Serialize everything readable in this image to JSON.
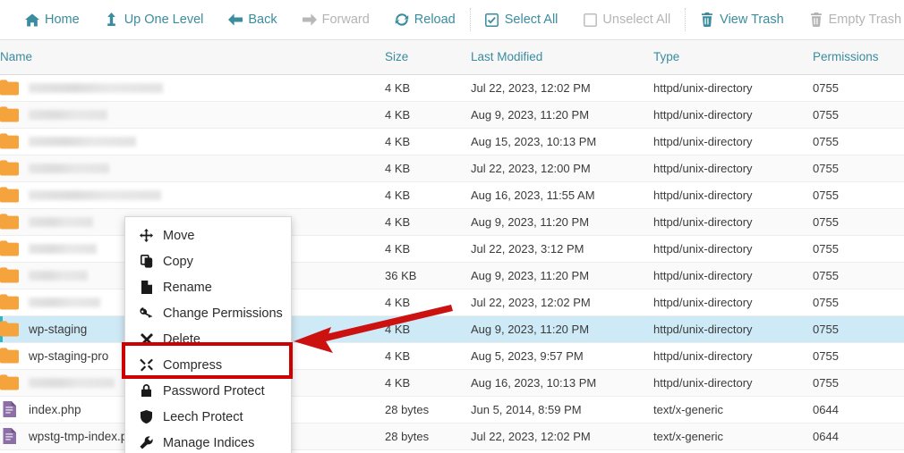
{
  "toolbar": {
    "items": [
      {
        "id": "home",
        "label": "Home",
        "icon": "home-icon",
        "disabled": false
      },
      {
        "id": "up-one-level",
        "label": "Up One Level",
        "icon": "arrow-up-icon",
        "disabled": false
      },
      {
        "id": "back",
        "label": "Back",
        "icon": "arrow-left-icon",
        "disabled": false
      },
      {
        "id": "forward",
        "label": "Forward",
        "icon": "arrow-right-icon",
        "disabled": true
      },
      {
        "id": "reload",
        "label": "Reload",
        "icon": "reload-icon",
        "disabled": false
      },
      {
        "id": "select-all",
        "label": "Select All",
        "icon": "checkbox-checked-icon",
        "disabled": false
      },
      {
        "id": "unselect-all",
        "label": "Unselect All",
        "icon": "checkbox-empty-icon",
        "disabled": true
      },
      {
        "id": "view-trash",
        "label": "View Trash",
        "icon": "trash-icon",
        "disabled": false
      },
      {
        "id": "empty-trash",
        "label": "Empty Trash",
        "icon": "trash-icon",
        "disabled": true
      }
    ]
  },
  "table": {
    "columns": [
      "Name",
      "Size",
      "Last Modified",
      "Type",
      "Permissions"
    ],
    "rows": [
      {
        "name": "",
        "redacted": true,
        "redact_w": 150,
        "icon": "folder-icon",
        "size": "4 KB",
        "modified": "Jul 22, 2023, 12:02 PM",
        "type": "httpd/unix-directory",
        "permissions": "0755",
        "selected": false
      },
      {
        "name": "",
        "redacted": true,
        "redact_w": 88,
        "icon": "folder-icon",
        "size": "4 KB",
        "modified": "Aug 9, 2023, 11:20 PM",
        "type": "httpd/unix-directory",
        "permissions": "0755",
        "selected": false
      },
      {
        "name": "",
        "redacted": true,
        "redact_w": 120,
        "icon": "folder-icon",
        "size": "4 KB",
        "modified": "Aug 15, 2023, 10:13 PM",
        "type": "httpd/unix-directory",
        "permissions": "0755",
        "selected": false
      },
      {
        "name": "",
        "redacted": true,
        "redact_w": 90,
        "icon": "folder-icon",
        "size": "4 KB",
        "modified": "Jul 22, 2023, 12:00 PM",
        "type": "httpd/unix-directory",
        "permissions": "0755",
        "selected": false
      },
      {
        "name": "",
        "redacted": true,
        "redact_w": 148,
        "icon": "folder-icon",
        "size": "4 KB",
        "modified": "Aug 16, 2023, 11:55 AM",
        "type": "httpd/unix-directory",
        "permissions": "0755",
        "selected": false
      },
      {
        "name": "",
        "redacted": true,
        "redact_w": 72,
        "icon": "folder-icon",
        "size": "4 KB",
        "modified": "Aug 9, 2023, 11:20 PM",
        "type": "httpd/unix-directory",
        "permissions": "0755",
        "selected": false
      },
      {
        "name": "",
        "redacted": true,
        "redact_w": 76,
        "icon": "folder-icon",
        "size": "4 KB",
        "modified": "Jul 22, 2023, 3:12 PM",
        "type": "httpd/unix-directory",
        "permissions": "0755",
        "selected": false
      },
      {
        "name": "",
        "redacted": true,
        "redact_w": 66,
        "icon": "folder-icon",
        "size": "36 KB",
        "modified": "Aug 9, 2023, 11:20 PM",
        "type": "httpd/unix-directory",
        "permissions": "0755",
        "selected": false
      },
      {
        "name": "",
        "redacted": true,
        "redact_w": 80,
        "icon": "folder-icon",
        "size": "4 KB",
        "modified": "Jul 22, 2023, 12:02 PM",
        "type": "httpd/unix-directory",
        "permissions": "0755",
        "selected": false
      },
      {
        "name": "wp-staging",
        "redacted": false,
        "redact_w": 0,
        "icon": "folder-icon",
        "size": "4 KB",
        "modified": "Aug 9, 2023, 11:20 PM",
        "type": "httpd/unix-directory",
        "permissions": "0755",
        "selected": true
      },
      {
        "name": "wp-staging-pro",
        "redacted": false,
        "redact_w": 0,
        "icon": "folder-icon",
        "size": "4 KB",
        "modified": "Aug 5, 2023, 9:57 PM",
        "type": "httpd/unix-directory",
        "permissions": "0755",
        "selected": false
      },
      {
        "name": "",
        "redacted": true,
        "redact_w": 96,
        "icon": "folder-icon",
        "size": "4 KB",
        "modified": "Aug 16, 2023, 10:13 PM",
        "type": "httpd/unix-directory",
        "permissions": "0755",
        "selected": false
      },
      {
        "name": "index.php",
        "redacted": false,
        "redact_w": 0,
        "icon": "file-icon",
        "size": "28 bytes",
        "modified": "Jun 5, 2014, 8:59 PM",
        "type": "text/x-generic",
        "permissions": "0644",
        "selected": false
      },
      {
        "name": "wpstg-tmp-index.php",
        "redacted": false,
        "redact_w": 0,
        "icon": "file-icon",
        "size": "28 bytes",
        "modified": "Jul 22, 2023, 12:02 PM",
        "type": "text/x-generic",
        "permissions": "0644",
        "selected": false
      }
    ]
  },
  "context_menu": {
    "items": [
      {
        "id": "move",
        "label": "Move",
        "icon": "move-icon",
        "highlighted": false
      },
      {
        "id": "copy",
        "label": "Copy",
        "icon": "copy-icon",
        "highlighted": false
      },
      {
        "id": "rename",
        "label": "Rename",
        "icon": "rename-file-icon",
        "highlighted": false
      },
      {
        "id": "change-permissions",
        "label": "Change Permissions",
        "icon": "key-icon",
        "highlighted": false
      },
      {
        "id": "delete",
        "label": "Delete",
        "icon": "x-mark-icon",
        "highlighted": false
      },
      {
        "id": "compress",
        "label": "Compress",
        "icon": "compress-icon",
        "highlighted": true
      },
      {
        "id": "password-protect",
        "label": "Password Protect",
        "icon": "lock-icon",
        "highlighted": false
      },
      {
        "id": "leech-protect",
        "label": "Leech Protect",
        "icon": "shield-icon",
        "highlighted": false
      },
      {
        "id": "manage-indices",
        "label": "Manage Indices",
        "icon": "wrench-icon",
        "highlighted": false
      }
    ]
  },
  "annotations": {
    "highlight_color": "#cc0000",
    "arrow_color": "#cc1111",
    "highlight_target": "compress",
    "arrow_points_to": "compress"
  },
  "colors": {
    "accent": "#3a8c9e",
    "folder": "#f5a33c",
    "file": "#8d6fa8",
    "selection": "#cfeaf7",
    "selection_bar": "#2eb8c6"
  }
}
